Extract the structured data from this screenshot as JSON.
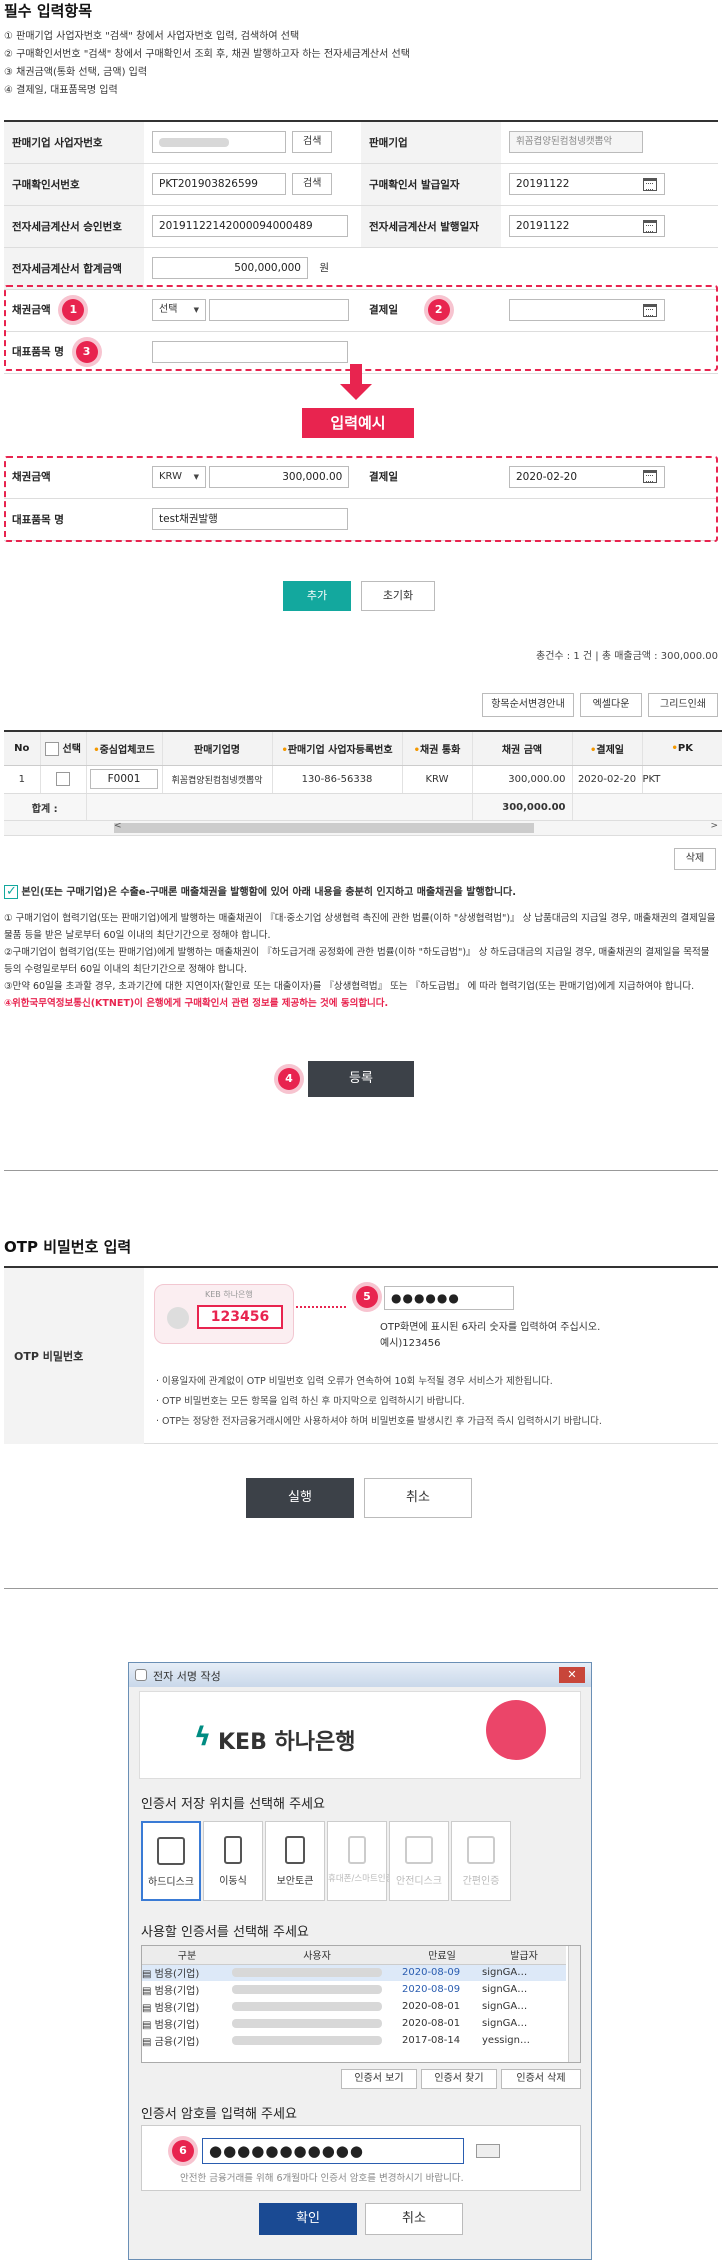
{
  "section1": {
    "title": "필수 입력항목",
    "steps": [
      "① 판매기업 사업자번호 \"검색\" 창에서 사업자번호 입력, 검색하여 선택",
      "② 구매확인서번호 \"검색\" 창에서 구매확인서 조회 후, 채권 발행하고자 하는 전자세금계산서 선택",
      "③ 채권금액(통화 선택, 금액) 입력",
      "④ 결제일, 대표품목명 입력"
    ]
  },
  "form": {
    "seller_biz_no_label": "판매기업 사업자번호",
    "search_label": "검색",
    "seller_label": "판매기업",
    "seller_value": "휘꼼켭양된컴첨넹캣뽑악",
    "confirm_no_label": "구매확인서번호",
    "confirm_no_value": "PKT201903826599",
    "confirm_date_label": "구매확인서 발급일자",
    "confirm_date_value": "20191122",
    "tax_no_label": "전자세금계산서 승인번호",
    "tax_no_value": "20191122142000094000489",
    "tax_date_label": "전자세금계산서 발행일자",
    "tax_date_value": "20191122",
    "total_label": "전자세금계산서 합계금액",
    "total_value": "500,000,000",
    "currency_unit": "원",
    "amount_label": "채권금액",
    "select_placeholder": "선택",
    "pay_date_label": "결제일",
    "item_label": "대표품목 명"
  },
  "example": {
    "banner": "입력예시",
    "amount_label": "채권금액",
    "currency": "KRW",
    "amount": "300,000.00",
    "pay_date_label": "결제일",
    "pay_date": "2020-02-20",
    "item_label": "대표품목 명",
    "item_value": "test채권발행"
  },
  "actions": {
    "add": "추가",
    "reset": "초기화"
  },
  "summary": {
    "text": "총건수 : 1 건  |  총 매출금액 : 300,000.00"
  },
  "tools": {
    "order": "항목순서변경안내",
    "excel": "엑셀다운",
    "grid_print": "그리드인쇄"
  },
  "grid": {
    "headers": [
      "No",
      "선택",
      "중심업체코드",
      "판매기업명",
      "판매기업 사업자등록번호",
      "채권 통화",
      "채권 금액",
      "결제일",
      "PK"
    ],
    "row": [
      "1",
      "",
      "F0001",
      "휘꼼켭양된컴첨넹캣뽑악",
      "130-86-56338",
      "KRW",
      "300,000.00",
      "2020-02-20",
      "PKT"
    ],
    "total_label": "합계 :",
    "total_value": "300,000.00",
    "delete": "삭제"
  },
  "agree": {
    "main": "본인(또는 구매기업)은 수출e-구매론 매출채권을 발행함에 있어 아래 내용을 충분히 인지하고 매출채권을 발행합니다.",
    "n1": "① 구매기업이 협력기업(또는 판매기업)에게 발행하는 매출채권이 『대·중소기업 상생협력 촉진에 관한 법률(이하 \"상생협력법\")』 상 납품대금의 지급일 경우, 매출채권의 결제일을 물품 등을 받은 날로부터 60일 이내의 최단기간으로 정해야 합니다.",
    "n2": "②구매기업이 협력기업(또는 판매기업)에게 발행하는 매출채권이 『하도급거래 공정화에 관한 법률(이하 \"하도급법\")』 상 하도급대금의 지급일 경우, 매출채권의 결제일을 목적물 등의 수령일로부터 60일 이내의 최단기간으로 정해야 합니다.",
    "n3": "③만약 60일을 초과할 경우, 초과기간에 대한 지연이자(할인료 또는 대출이자)를 『상생협력법』 또는 『하도급법』 에 따라 협력기업(또는 판매기업)에게 지급하여야 합니다.",
    "n4": "④위한국무역정보통신(KTNET)이 은행에게 구매확인서 관련 정보를 제공하는 것에 동의합니다.",
    "register": "등록"
  },
  "otp": {
    "title": "OTP 비밀번호 입력",
    "label": "OTP 비밀번호",
    "card_brand": "KEB 하나은행",
    "card_number": "123456",
    "masked": "●●●●●●",
    "hint1": "OTP화면에 표시된 6자리 숫자를 입력하여 주십시오.",
    "hint2": "예시)123456",
    "bullets": [
      "· 이용일자에 관계없이 OTP 비밀번호 입력 오류가 연속하여 10회 누적될 경우 서비스가 제한됩니다.",
      "· OTP 비밀번호는 모든 항목을 입력 하신 후 마지막으로 입력하시기 바랍니다.",
      "· OTP는 정당한 전자금융거래시에만 사용하셔야 하며 비밀번호를 발생시킨 후 가급적 즉시 입력하시기 바랍니다."
    ],
    "run": "실행",
    "cancel": "취소"
  },
  "sign": {
    "window_title": "전자 서명 작성",
    "bank": "KEB 하나은행",
    "location_title": "인증서 저장 위치를 선택해 주세요",
    "locations": [
      "하드디스크",
      "이동식",
      "보안토큰",
      "휴대폰/스마트인증",
      "안전디스크",
      "간편인증"
    ],
    "cert_title": "사용할 인증서를 선택해 주세요",
    "cols": [
      "구분",
      "사용자",
      "만료일",
      "발급자"
    ],
    "certs": [
      {
        "type": "범용(기업)",
        "exp": "2020-08-09",
        "issuer": "signGA…"
      },
      {
        "type": "범용(기업)",
        "exp": "2020-08-09",
        "issuer": "signGA…"
      },
      {
        "type": "범용(기업)",
        "exp": "2020-08-01",
        "issuer": "signGA…"
      },
      {
        "type": "범용(기업)",
        "exp": "2020-08-01",
        "issuer": "signGA…"
      },
      {
        "type": "금융(기업)",
        "exp": "2017-08-14",
        "issuer": "yessign…"
      }
    ],
    "view": "인증서 보기",
    "find": "인증서 찾기",
    "del": "인증서 삭제",
    "pw_title": "인증서 암호를 입력해 주세요",
    "pw_mask": "●●●●●●●●●●●",
    "pw_hint": "안전한 금융거래를 위해 6개월마다 인증서 암호를 변경하시기 바랍니다.",
    "ok": "확인",
    "cancel": "취소"
  },
  "badges": [
    "1",
    "2",
    "3",
    "4",
    "5",
    "6"
  ],
  "colors": {
    "accent": "#e8244f",
    "green": "#13a89e",
    "dark": "#3c4148"
  }
}
